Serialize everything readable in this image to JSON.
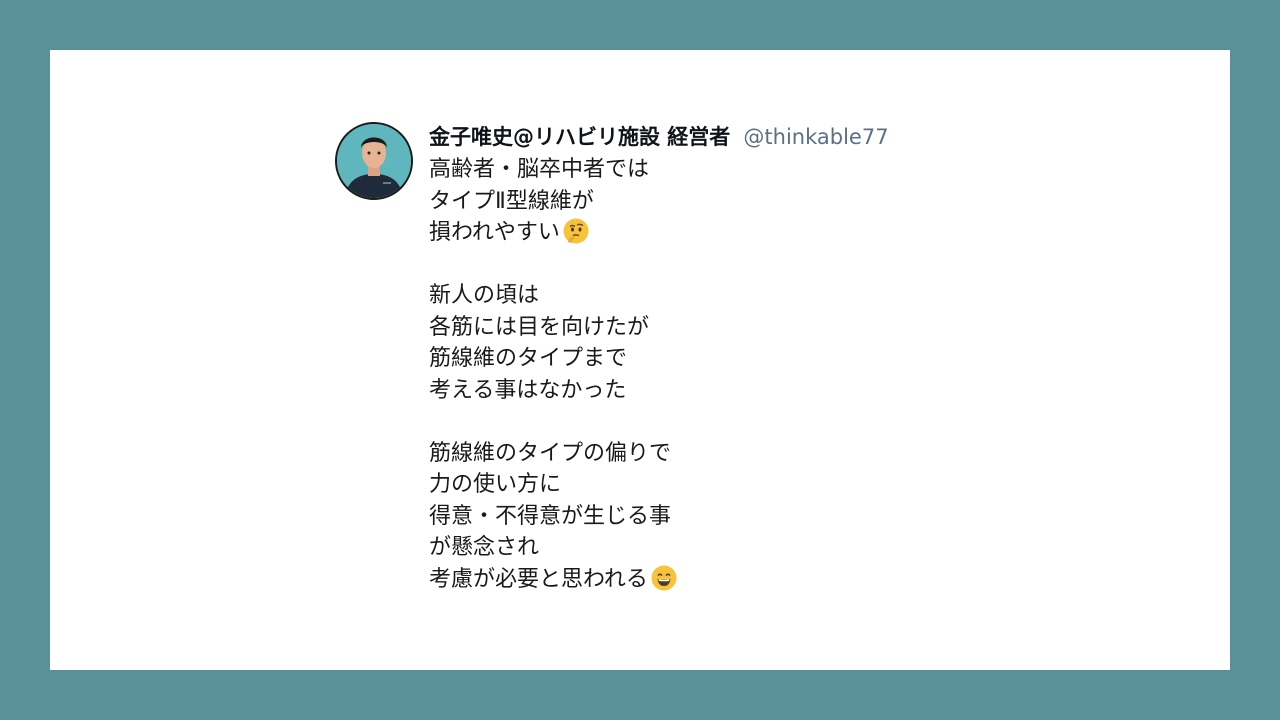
{
  "tweet": {
    "author_name": "金子唯史@リハビリ施設 経営者",
    "author_handle": "@thinkable77",
    "lines": [
      "高齢者・脳卒中者では",
      "タイプⅡ型線維が",
      "損われやすい",
      "",
      "新人の頃は",
      "各筋には目を向けたが",
      "筋線維のタイプまで",
      "考える事はなかった",
      "",
      "筋線維のタイプの偏りで",
      "力の使い方に",
      "得意・不得意が生じる事",
      "が懸念され",
      "考慮が必要と思われる"
    ],
    "emojis": {
      "line_3": "thinking-face-icon",
      "line_14": "grinning-face-icon"
    }
  },
  "colors": {
    "background": "#5a9199",
    "card": "#ffffff",
    "handle": "#5b7083"
  }
}
